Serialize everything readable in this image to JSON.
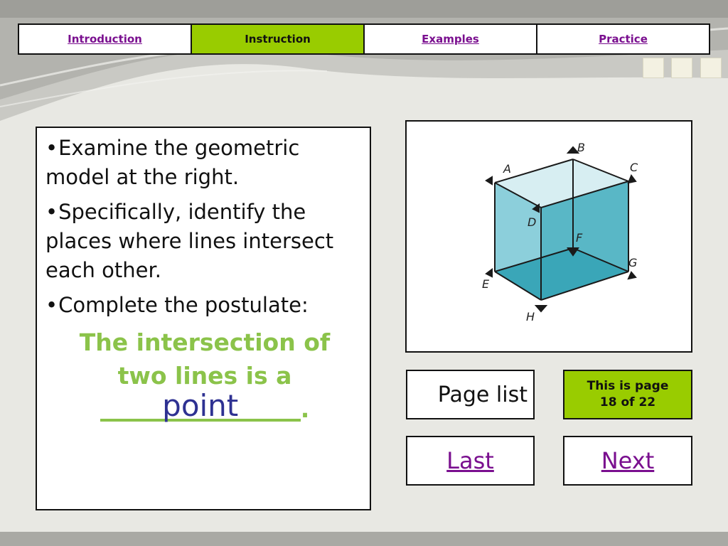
{
  "nav": {
    "tabs": [
      {
        "label": "Introduction",
        "active": false
      },
      {
        "label": "Instruction",
        "active": true
      },
      {
        "label": "Examples",
        "active": false
      },
      {
        "label": "Practice",
        "active": false
      }
    ]
  },
  "content": {
    "bullets": [
      "Examine the geometric model at the right.",
      "Specifically, identify the places where lines intersect each other.",
      "Complete the postulate:"
    ],
    "postulate_line1": "The intersection of",
    "postulate_line2": "two lines is a",
    "postulate_end": ".",
    "answer": "point"
  },
  "figure": {
    "labels": [
      "A",
      "B",
      "C",
      "D",
      "E",
      "F",
      "G",
      "H"
    ]
  },
  "controls": {
    "page_list": "Page list",
    "page_badge_line1": "This is page",
    "page_badge_line2": "18 of 22",
    "last": "Last",
    "next": "Next"
  },
  "colors": {
    "accent_green": "#99cc00",
    "postulate_green": "#8bc34a",
    "link_purple": "#7a0f8f",
    "answer_blue": "#2e3192",
    "cube_face": "#59b7c6"
  }
}
